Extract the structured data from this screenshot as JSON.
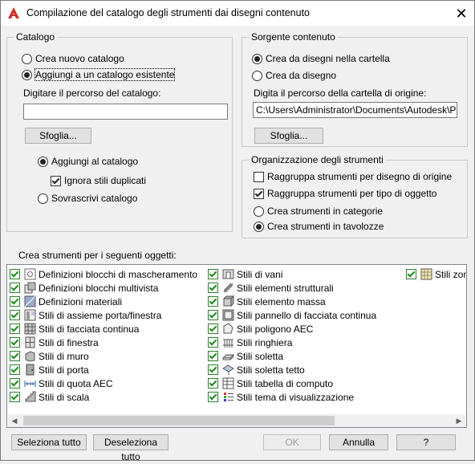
{
  "window": {
    "title": "Compilazione del catalogo degli strumenti dai disegni contenuto",
    "close_glyph": "✕",
    "app_icon": "autocad-a-icon"
  },
  "catalog": {
    "legend": "Catalogo",
    "create_new": "Crea nuovo catalogo",
    "add_existing": "Aggiungi a un catalogo esistente",
    "path_label": "Digitare il percorso del catalogo:",
    "path_value": "",
    "browse": "Sfoglia...",
    "add_to_catalog": "Aggiungi al catalogo",
    "ignore_duplicates": "Ignora stili duplicati",
    "overwrite": "Sovrascrivi catalogo"
  },
  "source": {
    "legend": "Sorgente contenuto",
    "from_folder": "Crea da disegni nella cartella",
    "from_drawing": "Crea da disegno",
    "path_label": "Digita il percorso della cartella di origine:",
    "path_value": "C:\\Users\\Administrator\\Documents\\Autodesk\\Progetti",
    "browse": "Sfoglia..."
  },
  "organization": {
    "legend": "Organizzazione degli strumenti",
    "group_by_drawing": "Raggruppa strumenti per disegno di origine",
    "group_by_type": "Raggruppa strumenti per tipo di oggetto",
    "in_categories": "Crea strumenti in categorie",
    "in_palettes": "Crea strumenti in tavolozze"
  },
  "objects": {
    "label": "Crea strumenti per i seguenti oggetti:",
    "col1": [
      {
        "label": "Definizioni blocchi di mascheramento",
        "icon": "mask-block-icon"
      },
      {
        "label": "Definizioni blocchi multivista",
        "icon": "multiview-block-icon"
      },
      {
        "label": "Definizioni materiali",
        "icon": "material-icon"
      },
      {
        "label": "Stili di assieme porta/finestra",
        "icon": "door-window-assembly-icon"
      },
      {
        "label": "Stili di facciata continua",
        "icon": "curtain-wall-icon"
      },
      {
        "label": "Stili di finestra",
        "icon": "window-icon"
      },
      {
        "label": "Stili di muro",
        "icon": "wall-icon"
      },
      {
        "label": "Stili di porta",
        "icon": "door-icon"
      },
      {
        "label": "Stili di quota AEC",
        "icon": "aec-dimension-icon"
      },
      {
        "label": "Stili di scala",
        "icon": "stair-icon"
      }
    ],
    "col2": [
      {
        "label": "Stili di vani",
        "icon": "opening-icon"
      },
      {
        "label": "Stili elementi strutturali",
        "icon": "structural-member-icon"
      },
      {
        "label": "Stili elemento massa",
        "icon": "mass-element-icon"
      },
      {
        "label": "Stili pannello di facciata continua",
        "icon": "curtain-wall-panel-icon"
      },
      {
        "label": "Stili poligono AEC",
        "icon": "aec-polygon-icon"
      },
      {
        "label": "Stili ringhiera",
        "icon": "railing-icon"
      },
      {
        "label": "Stili soletta",
        "icon": "slab-icon"
      },
      {
        "label": "Stili soletta tetto",
        "icon": "roof-slab-icon"
      },
      {
        "label": "Stili tabella di computo",
        "icon": "schedule-table-icon"
      },
      {
        "label": "Stili tema di visualizzazione",
        "icon": "display-theme-icon"
      }
    ],
    "col3": [
      {
        "label": "Stili zona",
        "icon": "zone-icon"
      }
    ]
  },
  "footer": {
    "select_all": "Seleziona tutto",
    "deselect_all": "Deseleziona tutto",
    "ok": "OK",
    "cancel": "Annulla",
    "help": "?"
  },
  "colors": {
    "title_icon_red": "#d0302a",
    "check_green": "#1f8a1f"
  }
}
